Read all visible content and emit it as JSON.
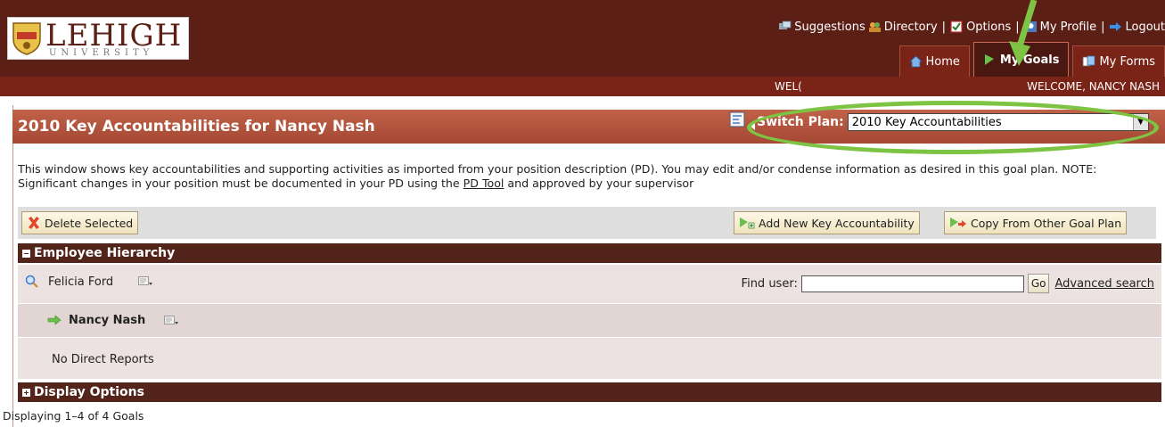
{
  "header": {
    "logo_word": "LEHIGH",
    "logo_sub": "UNIVERSITY",
    "links": [
      {
        "label": "Suggestions",
        "icon": "suggestions-icon"
      },
      {
        "label": "Directory",
        "icon": "directory-icon"
      },
      {
        "label": "Options",
        "icon": "options-icon"
      },
      {
        "label": "My Profile",
        "icon": "profile-icon"
      },
      {
        "label": "Logout",
        "icon": "logout-icon"
      }
    ],
    "tabs": [
      {
        "label": "Home",
        "icon": "home-icon",
        "active": false
      },
      {
        "label": "My Goals",
        "icon": "goals-icon",
        "active": true
      },
      {
        "label": "My Forms",
        "icon": "forms-icon",
        "active": false
      }
    ],
    "welcome_left": "WEL(",
    "welcome_right": "WELCOME, NANCY NASH"
  },
  "plan": {
    "title": "2010 Key Accountabilities for Nancy Nash",
    "switch_label": "Switch Plan:",
    "switch_value": "2010 Key Accountabilities"
  },
  "description": {
    "text1": "This window shows key accountabilities and supporting activities as imported from your position description (PD). You may edit and/or condense information as desired in this goal plan. NOTE: Significant changes in your position must be documented in your PD using the ",
    "link": "PD Tool",
    "text2": " and approved by your supervisor"
  },
  "toolbar": {
    "delete_label": "Delete Selected",
    "add_label": "Add New Key Accountability",
    "copy_label": "Copy From Other Goal Plan"
  },
  "hierarchy": {
    "section_label": "Employee Hierarchy",
    "supervisor": "Felicia Ford",
    "find_label": "Find user:",
    "find_value": "",
    "go_label": "Go",
    "advanced_label": "Advanced search",
    "current_user": "Nancy Nash",
    "no_reports": "No Direct Reports"
  },
  "display_options": {
    "section_label": "Display Options"
  },
  "footer": {
    "status": "Displaying 1–4 of 4 Goals"
  },
  "colors": {
    "brand": "#5b1f16",
    "titlebar": "#b4533d",
    "highlight": "#7ec444"
  }
}
